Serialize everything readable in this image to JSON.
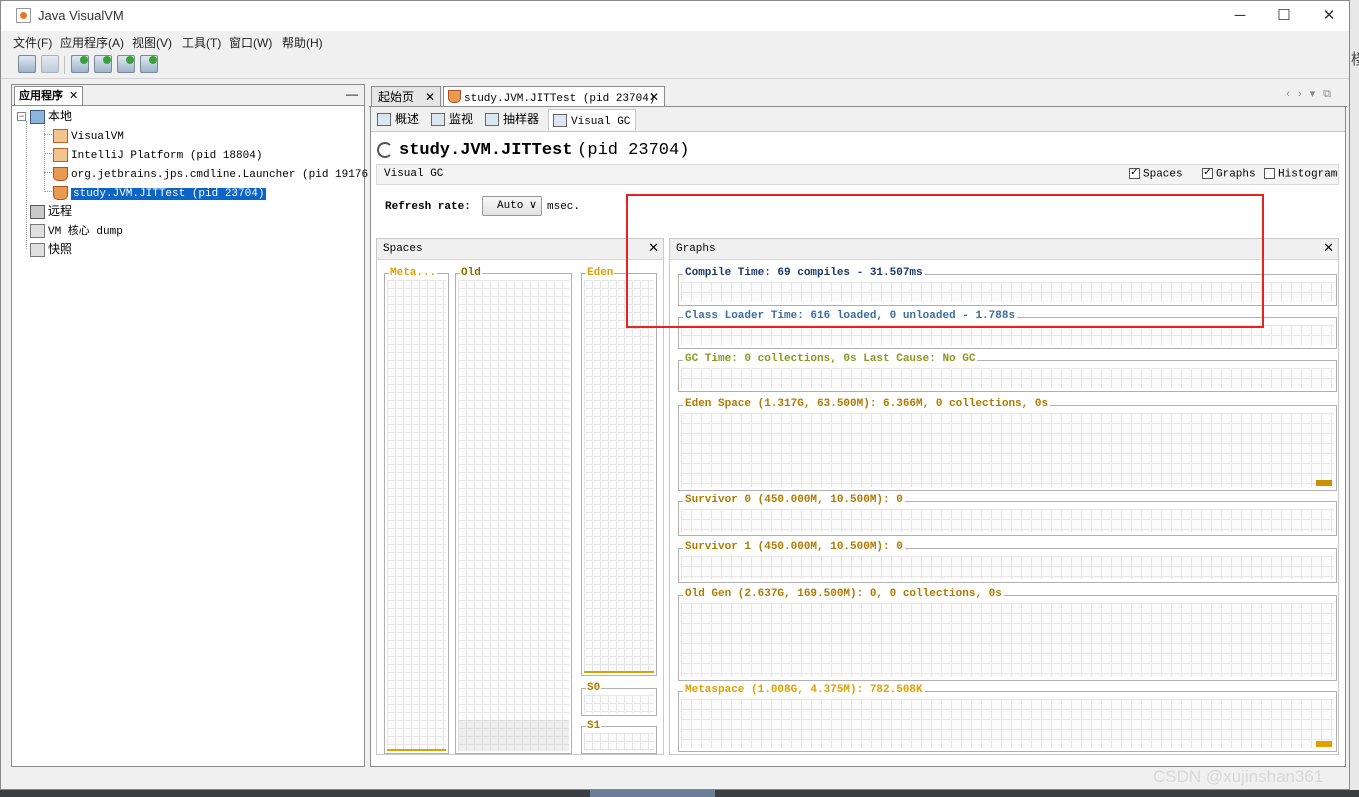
{
  "window": {
    "title": "Java VisualVM"
  },
  "menu": [
    "文件(F)",
    "应用程序(A)",
    "视图(V)",
    "工具(T)",
    "窗口(W)",
    "帮助(H)"
  ],
  "toolbar": {
    "buttons": [
      "open-icon",
      "save-icon",
      "add-jmx-icon",
      "add-remote-icon",
      "add-coredump-icon",
      "add-snapshot-icon"
    ]
  },
  "left_panel": {
    "tab_label": "应用程序",
    "tab_close": "✕",
    "minimize": "—",
    "tree": {
      "local": "本地",
      "local_items": [
        "VisualVM",
        "IntelliJ Platform (pid 18804)",
        "org.jetbrains.jps.cmdline.Launcher (pid 19176)",
        "study.JVM.JITTest (pid 23704)"
      ],
      "remote": "远程",
      "core_dump": "VM 核心 dump",
      "snapshots": "快照"
    }
  },
  "doc_tabs": [
    {
      "label": "起始页",
      "close": "✕"
    },
    {
      "label": "study.JVM.JITTest (pid 23704)",
      "close": "✕"
    }
  ],
  "sub_tabs": [
    "概述",
    "监视",
    "抽样器",
    "Visual GC"
  ],
  "header": {
    "title": "study.JVM.JITTest",
    "pid": "(pid 23704)"
  },
  "visual_gc": {
    "label": "Visual GC",
    "options": [
      {
        "label": "Spaces",
        "checked": true
      },
      {
        "label": "Graphs",
        "checked": true
      },
      {
        "label": "Histogram",
        "checked": false
      }
    ],
    "refresh_label": "Refresh rate:",
    "refresh_value": "Auto",
    "refresh_arrow": "∨",
    "refresh_unit": "msec."
  },
  "spaces": {
    "title": "Spaces",
    "close": "✕",
    "meta": "Meta...",
    "old": "Old",
    "eden": "Eden",
    "s0": "S0",
    "s1": "S1"
  },
  "graphs": {
    "title": "Graphs",
    "close": "✕",
    "items": [
      {
        "label": "Compile Time: 69 compiles - 31.507ms",
        "color": "#1c3a6e"
      },
      {
        "label": "Class Loader Time: 616 loaded, 0 unloaded - 1.788s",
        "color": "#3a6e9c"
      },
      {
        "label": "GC Time: 0 collections, 0s Last Cause: No GC",
        "color": "#8a9a1e"
      },
      {
        "label": "Eden Space (1.317G, 63.500M): 6.366M, 0 collections, 0s",
        "color": "#b07a00"
      },
      {
        "label": "Survivor 0 (450.000M, 10.500M): 0",
        "color": "#b07a00"
      },
      {
        "label": "Survivor 1 (450.000M, 10.500M): 0",
        "color": "#b07a00"
      },
      {
        "label": "Old Gen (2.637G, 169.500M): 0, 0 collections, 0s",
        "color": "#b07a00"
      },
      {
        "label": "Metaspace (1.008G, 4.375M): 782.508K",
        "color": "#e0a000"
      }
    ]
  },
  "colors": {
    "accent_selection": "#0b64c8",
    "annotation": "#e8231e",
    "space_fill": "#d4a000"
  },
  "watermark": "CSDN @xujinshan361"
}
